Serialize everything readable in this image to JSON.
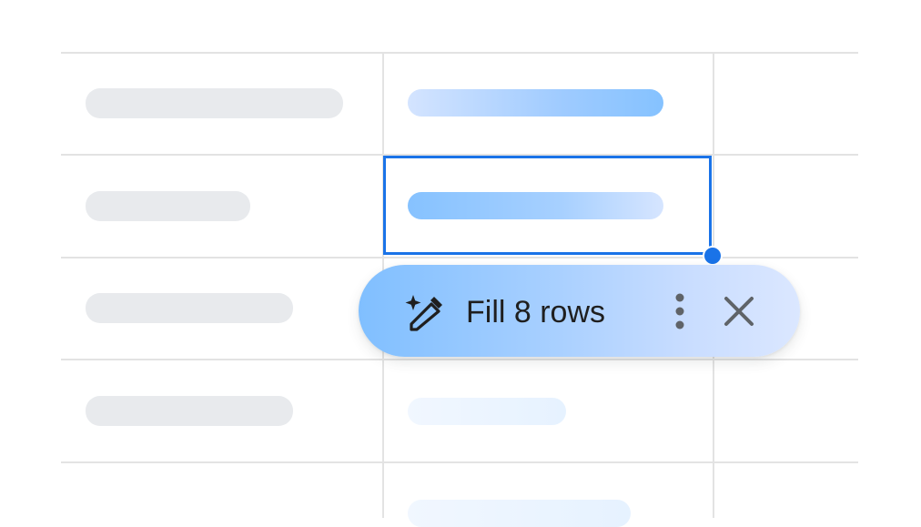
{
  "smart_fill_chip": {
    "label": "Fill 8 rows",
    "icon": "magic-wand-icon",
    "more_icon": "more-vert-icon",
    "close_icon": "close-icon"
  },
  "colors": {
    "selection": "#1a73e8",
    "gridline": "#e3e3e3",
    "placeholder_gray": "#e8eaed",
    "placeholder_blue": "#85c2ff"
  }
}
